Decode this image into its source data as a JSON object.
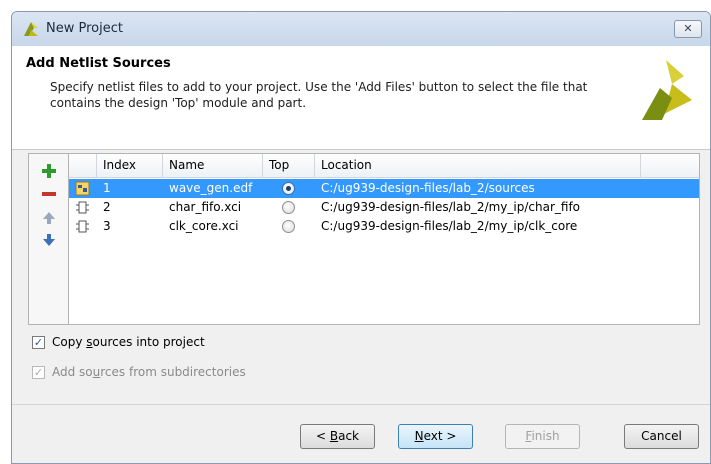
{
  "window": {
    "title": "New Project",
    "close_glyph": "✕"
  },
  "header": {
    "title": "Add Netlist Sources",
    "description": "Specify netlist files to add to your project. Use the 'Add Files' button to select the file that contains the design 'Top' module and part."
  },
  "toolbar": {
    "icons": [
      "add-icon",
      "remove-icon",
      "move-up-icon",
      "move-down-icon"
    ],
    "colors": {
      "add": "#2e9b2e",
      "remove": "#c0392b",
      "move": "#3d6fb4"
    }
  },
  "table": {
    "columns": [
      "Index",
      "Name",
      "Top",
      "Location"
    ],
    "rows": [
      {
        "index": "1",
        "name": "wave_gen.edf",
        "top": true,
        "location": "C:/ug939-design-files/lab_2/sources",
        "selected": true,
        "icon": "netlist-file-icon"
      },
      {
        "index": "2",
        "name": "char_fifo.xci",
        "top": false,
        "location": "C:/ug939-design-files/lab_2/my_ip/char_fifo",
        "selected": false,
        "icon": "ip-core-icon"
      },
      {
        "index": "3",
        "name": "clk_core.xci",
        "top": false,
        "location": "C:/ug939-design-files/lab_2/my_ip/clk_core",
        "selected": false,
        "icon": "ip-core-icon"
      }
    ],
    "selection_color": "#3399ff"
  },
  "options": {
    "copy_sources": {
      "pre": "Copy ",
      "mnemonic": "s",
      "post": "ources into project",
      "checked": true,
      "enabled": true
    },
    "add_subdirs": {
      "pre": "Add so",
      "mnemonic": "u",
      "post": "rces from subdirectories",
      "checked": true,
      "enabled": false
    }
  },
  "buttons": {
    "back": {
      "pre": "< ",
      "mnemonic": "B",
      "post": "ack"
    },
    "next": {
      "mnemonic": "N",
      "post": "ext >"
    },
    "finish": {
      "mnemonic": "F",
      "post": "inish"
    },
    "cancel": {
      "label": "Cancel"
    }
  }
}
